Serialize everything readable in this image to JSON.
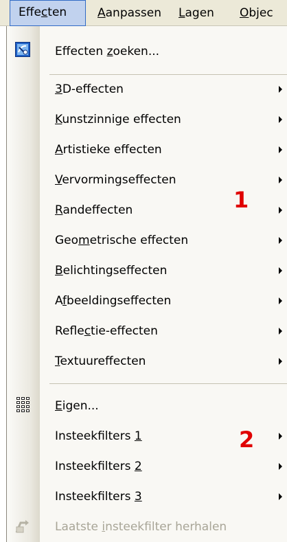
{
  "menubar": {
    "items": [
      {
        "label": "Effecten",
        "pre": "Effe",
        "u": "c",
        "post": "ten"
      },
      {
        "label": "Aanpassen",
        "pre": "",
        "u": "A",
        "post": "anpassen"
      },
      {
        "label": "Lagen",
        "pre": "",
        "u": "L",
        "post": "agen"
      },
      {
        "label": "Objec",
        "pre": "",
        "u": "O",
        "post": "bjec"
      }
    ]
  },
  "dropdown": {
    "search": {
      "pre": "Effecten ",
      "u": "z",
      "post": "oeken...",
      "icon": "effects-search-icon"
    },
    "effects": [
      {
        "pre": "",
        "u": "3",
        "post": "D-effecten"
      },
      {
        "pre": "",
        "u": "K",
        "post": "unstzinnige effecten"
      },
      {
        "pre": "",
        "u": "A",
        "post": "rtistieke effecten"
      },
      {
        "pre": "",
        "u": "V",
        "post": "ervormingseffecten"
      },
      {
        "pre": "",
        "u": "R",
        "post": "andeffecten"
      },
      {
        "pre": "Geo",
        "u": "m",
        "post": "etrische effecten"
      },
      {
        "pre": "",
        "u": "B",
        "post": "elichtingseffecten"
      },
      {
        "pre": "A",
        "u": "f",
        "post": "beeldingseffecten"
      },
      {
        "pre": "Refle",
        "u": "c",
        "post": "tie-effecten"
      },
      {
        "pre": "",
        "u": "T",
        "post": "extuureffecten"
      }
    ],
    "plugins": {
      "custom": {
        "pre": "",
        "u": "E",
        "post": "igen...",
        "icon": "grid-icon"
      },
      "filters": [
        {
          "pre": "Insteekfilters ",
          "u": "1",
          "post": ""
        },
        {
          "pre": "Insteekfilters ",
          "u": "2",
          "post": ""
        },
        {
          "pre": "Insteekfilters ",
          "u": "3",
          "post": ""
        }
      ],
      "repeat": {
        "pre": "Laatste ",
        "u": "i",
        "post": "nsteekfilter herhalen",
        "icon": "repeat-filter-icon"
      }
    }
  },
  "annotations": [
    "1",
    "2"
  ],
  "colors": {
    "menubar_bg": "#ece9d8",
    "active_menu": "#c1d2ee",
    "annotation": "#e00000",
    "disabled_text": "#a8a597"
  }
}
